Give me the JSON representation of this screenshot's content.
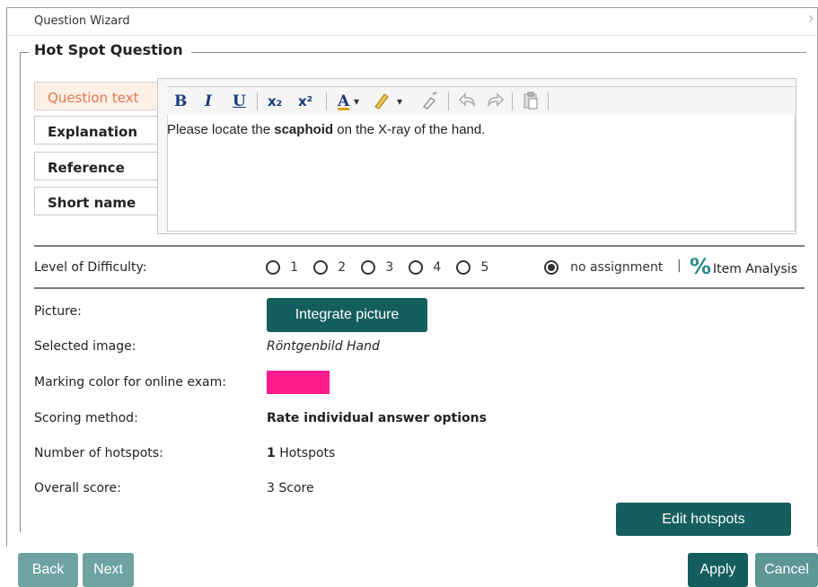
{
  "window": {
    "title": "Question Wizard",
    "close_glyph": "›"
  },
  "group_title": "Hot Spot Question",
  "tabs": [
    {
      "label": "Question text",
      "active": true
    },
    {
      "label": "Explanation"
    },
    {
      "label": "Reference"
    },
    {
      "label": "Short name"
    }
  ],
  "editor": {
    "toolbar": {
      "bold": "B",
      "italic": "I",
      "underline": "U",
      "subscript": "x₂",
      "superscript": "x²",
      "font_color": "A",
      "dropdown": "▾"
    },
    "content_before": "Please locate the ",
    "content_bold": "scaphoid",
    "content_after": " on the X-ray of the hand."
  },
  "difficulty": {
    "label": "Level of Difficulty:",
    "options": [
      "1",
      "2",
      "3",
      "4",
      "5"
    ],
    "no_assignment": "no assignment",
    "separator": "|",
    "percent_glyph": "%",
    "item_analysis": "Item Analysis"
  },
  "fields": {
    "picture_label": "Picture:",
    "integrate_button": "Integrate picture",
    "selected_image_label": "Selected image:",
    "selected_image_value": "Röntgenbild Hand",
    "marking_color_label": "Marking color for online exam:",
    "marking_color": "#ff1c8f",
    "scoring_label": "Scoring method:",
    "scoring_value": "Rate individual answer options",
    "hotspots_label": "Number of hotspots:",
    "hotspots_count": "1",
    "hotspots_unit": " Hotspots",
    "overall_label": "Overall score:",
    "overall_value": "3 Score"
  },
  "buttons": {
    "edit_hotspots": "Edit hotspots",
    "back": "Back",
    "next": "Next",
    "apply": "Apply",
    "cancel": "Cancel"
  },
  "colors": {
    "accent": "#155e5e",
    "accent_light": "#6fa3a3",
    "tab_active_text": "#e07850"
  }
}
